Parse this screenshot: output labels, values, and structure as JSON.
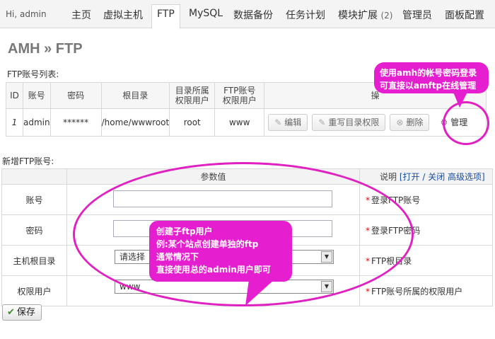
{
  "nav": {
    "user": "Hi, admin",
    "items": [
      {
        "label": "主页"
      },
      {
        "label": "虚拟主机"
      },
      {
        "label": "FTP"
      },
      {
        "label": "MySQL"
      },
      {
        "label": "数据备份"
      },
      {
        "label": "任务计划"
      },
      {
        "label": "模块扩展",
        "count": "(2)"
      },
      {
        "label": "管理员"
      },
      {
        "label": "面板配置"
      }
    ]
  },
  "page_title": "AMH » FTP",
  "list_section": {
    "label": "FTP账号列表:",
    "headers": [
      "ID",
      "账号",
      "密码",
      "根目录",
      "目录所属",
      "权限用户",
      "FTP账号",
      "权限用户",
      "操"
    ],
    "row": {
      "id": "1",
      "account": "admin",
      "password": "******",
      "root": "/home/wwwroot",
      "dir_owner": "root",
      "ftp_owner": "www",
      "buttons": {
        "edit": "编辑",
        "rewrite": "重写目录权限",
        "delete": "删除",
        "manage": "管理"
      }
    }
  },
  "add_section": {
    "label": "新增FTP账号:",
    "param_header": "参数值",
    "desc_header": "说明",
    "desc_links": [
      "[打开 / 关闭 高级选项]"
    ],
    "fields": [
      {
        "label": "账号",
        "desc": "登录FTP账号",
        "value": ""
      },
      {
        "label": "密码",
        "desc": "登录FTP密码",
        "value": ""
      },
      {
        "label": "主机根目录",
        "desc": "FTP根目录",
        "value": "请选择"
      },
      {
        "label": "权限用户",
        "desc": "FTP账号所属的权限用户",
        "value": "www"
      }
    ],
    "save": "保存"
  },
  "annotations": {
    "top": [
      "使用amh的帐号密码登录",
      "可直接以amftp在线管理"
    ],
    "middle": [
      "创建子ftp用户",
      "例:某个站点创建单独的ftp",
      "通常情况下",
      "直接使用总的admin用户即可"
    ]
  },
  "colors": {
    "annotation": "#e51fd0",
    "required": "#ee0000",
    "link": "#1a4fa0"
  }
}
